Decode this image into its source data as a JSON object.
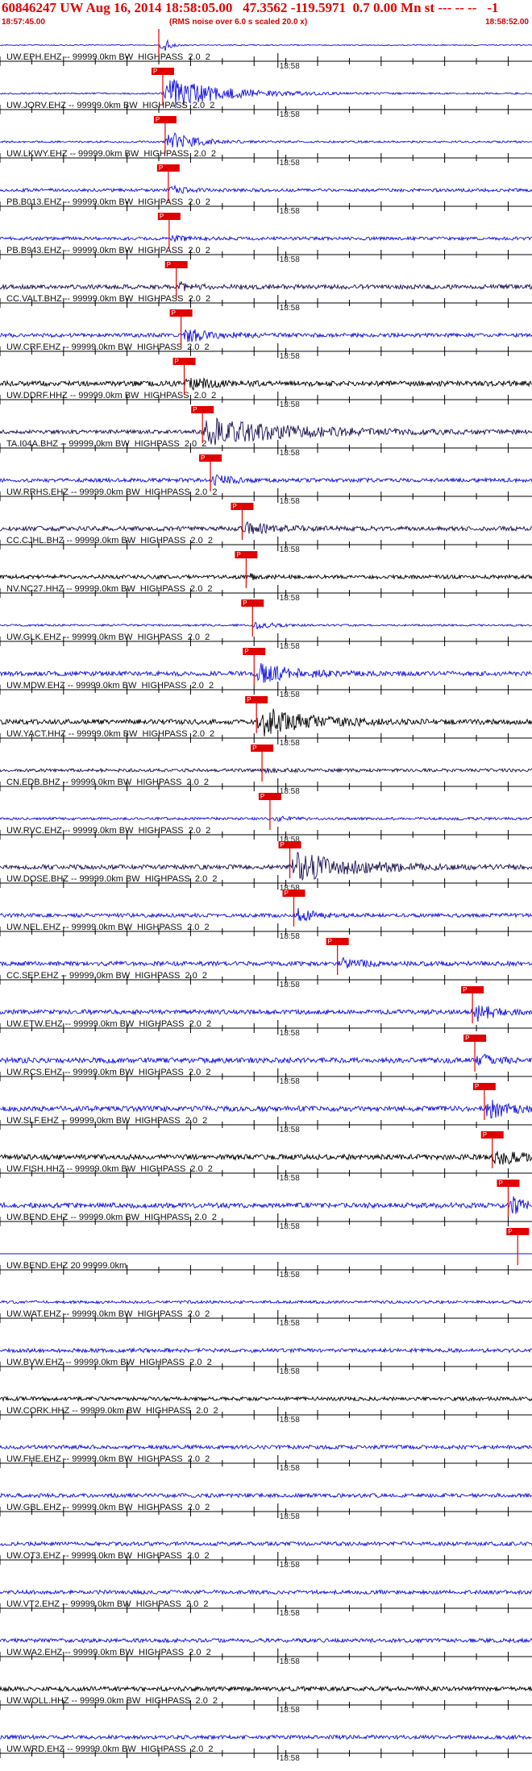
{
  "header": {
    "title": "60846247 UW Aug 16, 2014 18:58:05.00   47.3562 -119.5971  0.7 0.00 Mn st --- -- --   -1",
    "start_time": "18:57:45.00",
    "scale_note": "(RMS noise over 6.0 s scaled 20.0 x)",
    "end_time": "18:58:52.00"
  },
  "colors": {
    "title": "#e00000",
    "blue_trace": "#1010e0",
    "dark_trace": "#000000",
    "navy_trace": "#1a1050",
    "pick_box": "#e00000",
    "pick_line": "#e00000"
  },
  "chart_data": {
    "type": "seismogram",
    "time_range_s": [
      -20,
      47
    ],
    "origin_time": "18:58:05.00",
    "tick_interval_s": 4,
    "minute_label_time_s": 15,
    "minute_label": "18:58",
    "pick_label": "P",
    "channels": [
      {
        "label": "UW.EPH.EHZ -- 99999.0km BW_HIGHPASS_2.0_2",
        "color": "blue",
        "pick_s": 0.0,
        "event_amp": 1.2,
        "noise": 0.08,
        "event_len": 2
      },
      {
        "label": "UW.JORV.EHZ -- 99999.0km BW_HIGHPASS_2.0_2",
        "color": "blue",
        "pick_s": 0.5,
        "event_amp": 2.5,
        "noise": 0.12,
        "event_len": 14
      },
      {
        "label": "UW.LKWY.EHZ -- 99999.0km BW_HIGHPASS_2.0_2",
        "color": "blue",
        "pick_s": 0.8,
        "event_amp": 1.8,
        "noise": 0.15,
        "event_len": 6
      },
      {
        "label": "PB.B013.EHZ -- 99999.0km BW_HIGHPASS_2.0_2",
        "color": "blue",
        "pick_s": 1.2,
        "event_amp": 0.5,
        "noise": 0.25,
        "event_len": 4
      },
      {
        "label": "PB.B943.EHZ -- 99999.0km BW_HIGHPASS_2.0_2",
        "color": "blue",
        "pick_s": 1.3,
        "event_amp": 0.4,
        "noise": 0.25,
        "event_len": 4
      },
      {
        "label": "CC.VALT.BHZ -- 99999.0km BW_HIGHPASS_2.0_2",
        "color": "navy",
        "pick_s": 2.2,
        "event_amp": 0.6,
        "noise": 0.35,
        "event_len": 4
      },
      {
        "label": "UW.CRF.EHZ -- 99999.0km BW_HIGHPASS_2.0_2",
        "color": "blue",
        "pick_s": 2.8,
        "event_amp": 1.0,
        "noise": 0.3,
        "event_len": 8
      },
      {
        "label": "UW.DDRF.HHZ -- 99999.0km BW_HIGHPASS_2.0_2",
        "color": "dark",
        "pick_s": 3.2,
        "event_amp": 0.8,
        "noise": 0.4,
        "event_len": 6
      },
      {
        "label": "TA.I04A.BHZ -- 99999.0km BW_HIGHPASS_2.0_2",
        "color": "navy",
        "pick_s": 5.5,
        "event_amp": 2.0,
        "noise": 0.3,
        "event_len": 24
      },
      {
        "label": "UW.RRHS.EHZ -- 99999.0km BW_HIGHPASS_2.0_2",
        "color": "blue",
        "pick_s": 6.5,
        "event_amp": 0.9,
        "noise": 0.3,
        "event_len": 4
      },
      {
        "label": "CC.CJHL.BHZ -- 99999.0km BW_HIGHPASS_2.0_2",
        "color": "navy",
        "pick_s": 10.5,
        "event_amp": 0.7,
        "noise": 0.35,
        "event_len": 8
      },
      {
        "label": "NV.NC27.HHZ -- 99999.0km BW_HIGHPASS_2.0_2",
        "color": "dark",
        "pick_s": 11.0,
        "event_amp": 0.3,
        "noise": 0.3,
        "event_len": 4
      },
      {
        "label": "UW.GLK.EHZ -- 99999.0km BW_HIGHPASS_2.0_2",
        "color": "blue",
        "pick_s": 11.8,
        "event_amp": 0.6,
        "noise": 0.15,
        "event_len": 4
      },
      {
        "label": "UW.MDW.EHZ -- 99999.0km BW_HIGHPASS_2.0_2",
        "color": "blue",
        "pick_s": 12.0,
        "event_amp": 1.5,
        "noise": 0.35,
        "event_len": 10
      },
      {
        "label": "UW.YACT.HHZ -- 99999.0km BW_HIGHPASS_2.0_2",
        "color": "dark",
        "pick_s": 12.3,
        "event_amp": 2.2,
        "noise": 0.4,
        "event_len": 12
      },
      {
        "label": "CN.EDB.BHZ -- 99999.0km BW_HIGHPASS_2.0_2",
        "color": "navy",
        "pick_s": 13.0,
        "event_amp": 0.3,
        "noise": 0.25,
        "event_len": 4
      },
      {
        "label": "UW.RVC.EHZ -- 99999.0km BW_HIGHPASS_2.0_2",
        "color": "blue",
        "pick_s": 14.0,
        "event_amp": 0.3,
        "noise": 0.2,
        "event_len": 4
      },
      {
        "label": "UW.DOSE.BHZ -- 99999.0km BW_HIGHPASS_2.0_2",
        "color": "navy",
        "pick_s": 16.5,
        "event_amp": 2.2,
        "noise": 0.35,
        "event_len": 16
      },
      {
        "label": "UW.NEL.EHZ -- 99999.0km BW_HIGHPASS_2.0_2",
        "color": "blue",
        "pick_s": 17.0,
        "event_amp": 1.0,
        "noise": 0.3,
        "event_len": 4
      },
      {
        "label": "CC.SEP.EHZ -- 99999.0km BW_HIGHPASS_2.0_2",
        "color": "blue",
        "pick_s": 22.5,
        "event_amp": 0.8,
        "noise": 0.35,
        "event_len": 6
      },
      {
        "label": "UW.ETW.EHZ -- 99999.0km BW_HIGHPASS_2.0_2",
        "color": "blue",
        "pick_s": 39.5,
        "event_amp": 1.4,
        "noise": 0.35,
        "event_len": 5
      },
      {
        "label": "UW.RCS.EHZ -- 99999.0km BW_HIGHPASS_2.0_2",
        "color": "blue",
        "pick_s": 39.8,
        "event_amp": 0.8,
        "noise": 0.4,
        "event_len": 4
      },
      {
        "label": "UW.SLF.EHZ -- 99999.0km BW_HIGHPASS_2.0_2",
        "color": "blue",
        "pick_s": 41.0,
        "event_amp": 1.6,
        "noise": 0.4,
        "event_len": 5
      },
      {
        "label": "UW.FISH.HHZ -- 99999.0km BW_HIGHPASS_2.0_2",
        "color": "dark",
        "pick_s": 42.0,
        "event_amp": 1.2,
        "noise": 0.4,
        "event_len": 6
      },
      {
        "label": "UW.BEND.EHZ -- 99999.0km BW_HIGHPASS_2.0_2",
        "color": "blue",
        "pick_s": 44.0,
        "event_amp": 1.5,
        "noise": 0.4,
        "event_len": 3
      },
      {
        "label": "UW.BEND.EHZ 20 99999.0km",
        "color": "blue",
        "pick_s": 45.2,
        "event_amp": 0.0,
        "noise": 0.0,
        "event_len": 0
      },
      {
        "label": "UW.WAT.EHZ -- 99999.0km BW_HIGHPASS_2.0_2",
        "color": "blue",
        "pick_s": null,
        "event_amp": 0,
        "noise": 0.22,
        "event_len": 0
      },
      {
        "label": "UW.BVW.EHZ -- 99999.0km BW_HIGHPASS_2.0_2",
        "color": "blue",
        "pick_s": null,
        "event_amp": 0,
        "noise": 0.3,
        "event_len": 0
      },
      {
        "label": "UW.CORK.HHZ -- 99999.0km BW_HIGHPASS_2.0_2",
        "color": "dark",
        "pick_s": null,
        "event_amp": 0,
        "noise": 0.3,
        "event_len": 0
      },
      {
        "label": "UW.FHE.EHZ -- 99999.0km BW_HIGHPASS_2.0_2",
        "color": "blue",
        "pick_s": null,
        "event_amp": 0,
        "noise": 0.3,
        "event_len": 0
      },
      {
        "label": "UW.GBL.EHZ -- 99999.0km BW_HIGHPASS_2.0_2",
        "color": "blue",
        "pick_s": null,
        "event_amp": 0,
        "noise": 0.3,
        "event_len": 0
      },
      {
        "label": "UW.OT3.EHZ -- 99999.0km BW_HIGHPASS_2.0_2",
        "color": "blue",
        "pick_s": null,
        "event_amp": 0,
        "noise": 0.3,
        "event_len": 0
      },
      {
        "label": "UW.VT2.EHZ -- 99999.0km BW_HIGHPASS_2.0_2",
        "color": "blue",
        "pick_s": null,
        "event_amp": 0,
        "noise": 0.3,
        "event_len": 0
      },
      {
        "label": "UW.WA2.EHZ -- 99999.0km BW_HIGHPASS_2.0_2",
        "color": "blue",
        "pick_s": null,
        "event_amp": 0,
        "noise": 0.3,
        "event_len": 0
      },
      {
        "label": "UW.WOLL.HHZ -- 99999.0km BW_HIGHPASS_2.0_2",
        "color": "dark",
        "pick_s": null,
        "event_amp": 0,
        "noise": 0.35,
        "event_len": 0
      },
      {
        "label": "UW.WRD.EHZ -- 99999.0km BW_HIGHPASS_2.0_2",
        "color": "blue",
        "pick_s": null,
        "event_amp": 0,
        "noise": 0.3,
        "event_len": 0
      }
    ]
  }
}
